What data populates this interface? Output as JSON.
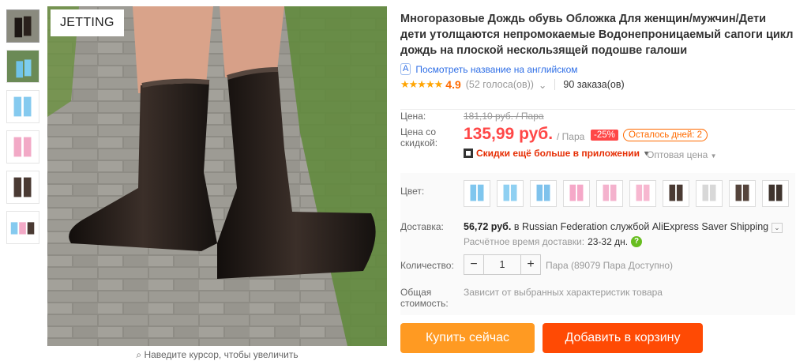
{
  "brand": "JETTING",
  "zoom_hint": "Наведите курсор, чтобы увеличить",
  "product": {
    "title": "Многоразовые Дождь обувь Обложка Для женщин/мужчин/Дети дети утолщаются непромокаемые Водонепроницаемый сапоги цикл дождь на плоской нескользящей подошве галоши",
    "translate_label": "Посмотреть название на английском",
    "rating_stars": "★★★★★",
    "rating": "4.9",
    "votes": "(52 голоса(ов))",
    "orders": "90 заказа(ов)"
  },
  "price": {
    "old_label": "Цена:",
    "old": "181,10 руб. / Пара",
    "discount_label_1": "Цена со",
    "discount_label_2": "скидкой:",
    "current": "135,99 руб.",
    "unit": "/ Пара",
    "discount": "-25%",
    "days_left": "Осталось дней: 2",
    "app_deal": "Скидки ещё больше в приложении",
    "wholesale": "Оптовая цена"
  },
  "color": {
    "label": "Цвет:",
    "swatches": [
      "#7fc6ee",
      "#8fd0f2",
      "#7fc2ec",
      "#f5a8c8",
      "#f4b2cd",
      "#f7b7d0",
      "#4a3a33",
      "#d8d8d8",
      "#55443c",
      "#3f342e"
    ]
  },
  "shipping": {
    "label": "Доставка:",
    "cost": "56,72 руб.",
    "to": "в Russian Federation службой AliExpress Saver Shipping",
    "estimate_label": "Расчётное время доставки:",
    "estimate": "23-32 дн."
  },
  "quantity": {
    "label": "Количество:",
    "value": "1",
    "minus": "−",
    "plus": "+",
    "available": "Пара (89079 Пара Доступно)"
  },
  "total": {
    "label_1": "Общая",
    "label_2": "стоимость:",
    "text": "Зависит от выбранных характеристик товара"
  },
  "buttons": {
    "buy": "Купить сейчас",
    "cart": "Добавить в корзину"
  }
}
